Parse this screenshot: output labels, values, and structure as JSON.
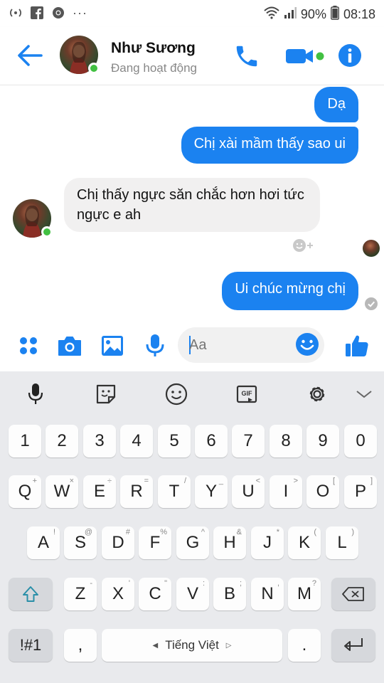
{
  "status_bar": {
    "left_icons": [
      "wifi-calling-icon",
      "facebook-icon",
      "chrome-icon"
    ],
    "more": "···",
    "battery": "90%",
    "time": "08:18"
  },
  "header": {
    "name": "Như Sương",
    "status": "Đang hoạt động"
  },
  "messages": [
    {
      "direction": "out",
      "text": "Dạ"
    },
    {
      "direction": "out",
      "text": "Chị xài mầm thấy sao ui"
    },
    {
      "direction": "in",
      "text": "Chị thấy ngực săn chắc hơn hơi tức ngực e ah"
    },
    {
      "direction": "out",
      "text": "Ui chúc mừng chị"
    }
  ],
  "composer": {
    "placeholder": "Aa"
  },
  "keyboard": {
    "numbers": [
      "1",
      "2",
      "3",
      "4",
      "5",
      "6",
      "7",
      "8",
      "9",
      "0"
    ],
    "row_q": [
      {
        "k": "Q",
        "h": "+"
      },
      {
        "k": "W",
        "h": "×"
      },
      {
        "k": "E",
        "h": "÷"
      },
      {
        "k": "R",
        "h": "="
      },
      {
        "k": "T",
        "h": "/"
      },
      {
        "k": "Y",
        "h": "_"
      },
      {
        "k": "U",
        "h": "<"
      },
      {
        "k": "I",
        "h": ">"
      },
      {
        "k": "O",
        "h": "["
      },
      {
        "k": "P",
        "h": "]"
      }
    ],
    "row_a": [
      {
        "k": "A",
        "h": "!"
      },
      {
        "k": "S",
        "h": "@"
      },
      {
        "k": "D",
        "h": "#"
      },
      {
        "k": "F",
        "h": "%"
      },
      {
        "k": "G",
        "h": "^"
      },
      {
        "k": "H",
        "h": "&"
      },
      {
        "k": "J",
        "h": "*"
      },
      {
        "k": "K",
        "h": "("
      },
      {
        "k": "L",
        "h": ")"
      }
    ],
    "row_z": [
      {
        "k": "Z",
        "h": "-"
      },
      {
        "k": "X",
        "h": "'"
      },
      {
        "k": "C",
        "h": "\""
      },
      {
        "k": "V",
        "h": ":"
      },
      {
        "k": "B",
        "h": ";"
      },
      {
        "k": "N",
        "h": ","
      },
      {
        "k": "M",
        "h": "?"
      }
    ],
    "symbols_key": "!#1",
    "comma_key": ",",
    "space_key": "Tiếng Việt",
    "period_key": "."
  },
  "colors": {
    "accent": "#1b82f0",
    "online": "#42c042",
    "incoming_bubble": "#f1f0f0",
    "keyboard_bg": "#e9eaed"
  }
}
